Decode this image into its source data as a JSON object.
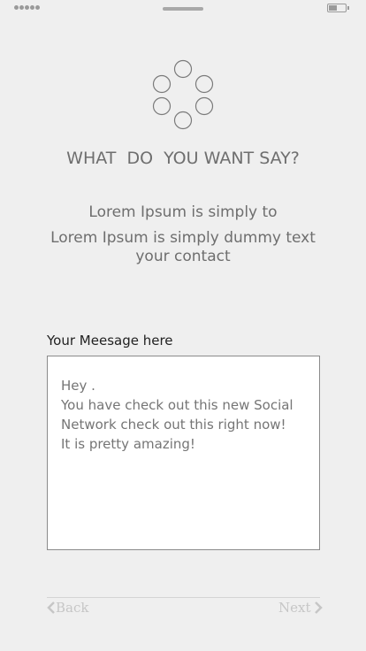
{
  "header": {
    "title": "WHAT  DO  YOU WANT SAY?"
  },
  "intro": {
    "line1": "Lorem Ipsum is simply to",
    "line2": "Lorem Ipsum is simply dummy text your contact"
  },
  "message": {
    "label": "Your Meesage here",
    "placeholder": "Hey .\nYou have check out this new Social Network check out this right now!\nIt is pretty amazing!"
  },
  "navigation": {
    "back_label": "Back",
    "next_label": "Next"
  },
  "icons": {
    "loader": "loader-icon",
    "back": "chevron-left-icon",
    "next": "chevron-right-icon",
    "battery": "battery-icon"
  }
}
